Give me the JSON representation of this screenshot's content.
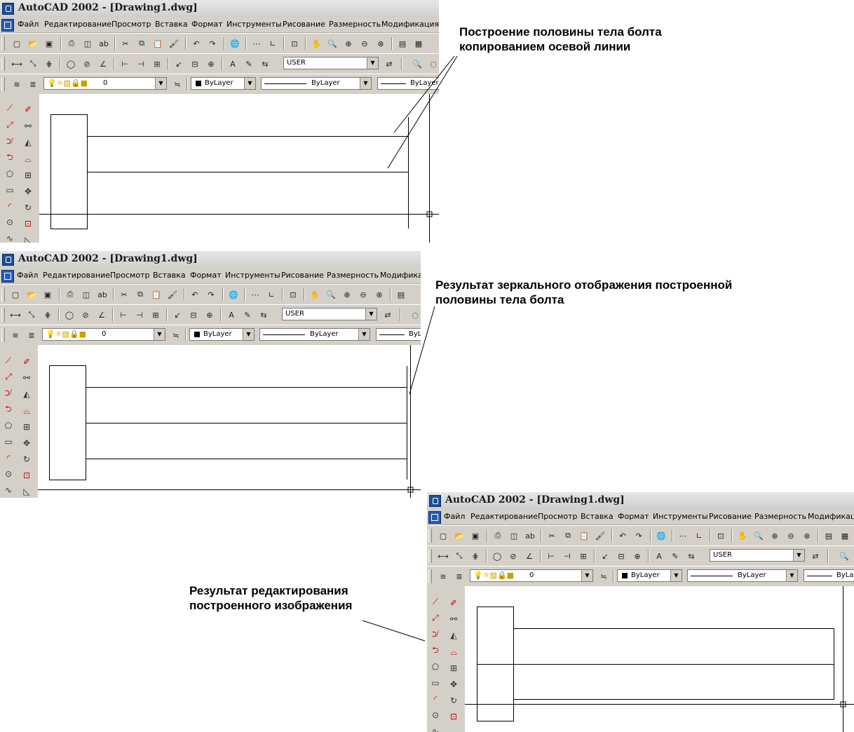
{
  "window": {
    "title": "AutoCAD 2002 - [Drawing1.dwg]",
    "menu": [
      "Файл",
      "Редактирование",
      "Просмотр",
      "Вставка",
      "Формат",
      "Инструменты",
      "Рисование",
      "Размерность",
      "Модификация"
    ],
    "ucs_combo": "USER",
    "layer_combo": "0",
    "color_combo": "ByLayer",
    "linetype_combo": "ByLayer",
    "lineweight_combo": "ByLayer"
  },
  "captions": {
    "step1_line1": "Построение половины тела болта",
    "step1_line2": "копированием осевой линии",
    "step2_line1": "Результат зеркального отображения построенной",
    "step2_line2": "половины тела болта",
    "step3_line1": "Результат редактирования",
    "step3_line2": "построенного изображения"
  },
  "icons": {
    "toolbar1": [
      "new-icon",
      "open-icon",
      "save-icon",
      "print-icon",
      "preview-icon",
      "spell-icon",
      "cut-icon",
      "copy-icon",
      "paste-icon",
      "match-prop-icon",
      "undo-icon",
      "redo-icon",
      "hyperlink-icon",
      "tracking-icon",
      "ucs-icon",
      "aerial-icon",
      "pan-icon",
      "zoom-realtime-icon",
      "zoom-window-icon",
      "zoom-prev-icon",
      "properties-icon"
    ],
    "draw_tools": [
      "line-icon",
      "xline-icon",
      "pline-icon",
      "polygon-icon",
      "rectangle-icon",
      "arc-icon",
      "circle-icon",
      "spline-icon"
    ],
    "modify_tools": [
      "erase-icon",
      "copy-object-icon",
      "mirror-icon",
      "offset-icon",
      "array-icon",
      "move-icon",
      "rotate-icon",
      "scale-icon"
    ]
  }
}
